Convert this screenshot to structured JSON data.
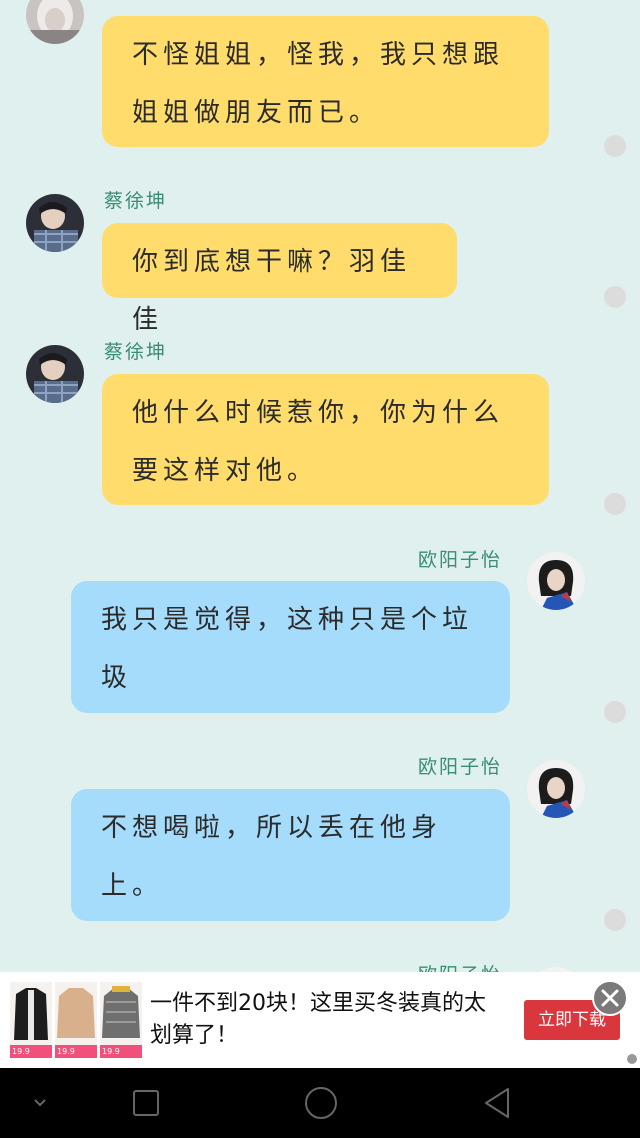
{
  "messages": [
    {
      "side": "left",
      "sender": "",
      "text": "不怪姐姐，怪我，我只想跟姐姐做朋友而已。",
      "avatar": "avatar-girl-white-hair"
    },
    {
      "side": "left",
      "sender": "蔡徐坤",
      "text": "你到底想干嘛？羽佳佳",
      "avatar": "avatar-boy-plaid"
    },
    {
      "side": "left",
      "sender": "蔡徐坤",
      "text": "他什么时候惹你，你为什么要这样对他。",
      "avatar": "avatar-boy-plaid"
    },
    {
      "side": "right",
      "sender": "欧阳子怡",
      "text": "我只是觉得，这种只是个垃圾",
      "avatar": "avatar-girl-blue"
    },
    {
      "side": "right",
      "sender": "欧阳子怡",
      "text": "不想喝啦，所以丢在他身上。",
      "avatar": "avatar-girl-blue"
    }
  ],
  "ad": {
    "headline": "一件不到20块！这里买冬装真的太划算了！",
    "cta": "立即下载",
    "prices": [
      "19.9",
      "19.9",
      "19.9"
    ],
    "close_icon": "close-icon"
  },
  "navbar": {
    "icons": [
      "chevron-down-icon",
      "square-icon",
      "circle-icon",
      "triangle-back-icon"
    ]
  },
  "colors": {
    "background": "#dff0ee",
    "left_bubble": "#ffdc6b",
    "right_bubble": "#a6dcfb",
    "sender_name": "#3a8c72",
    "cta": "#d9363e"
  }
}
